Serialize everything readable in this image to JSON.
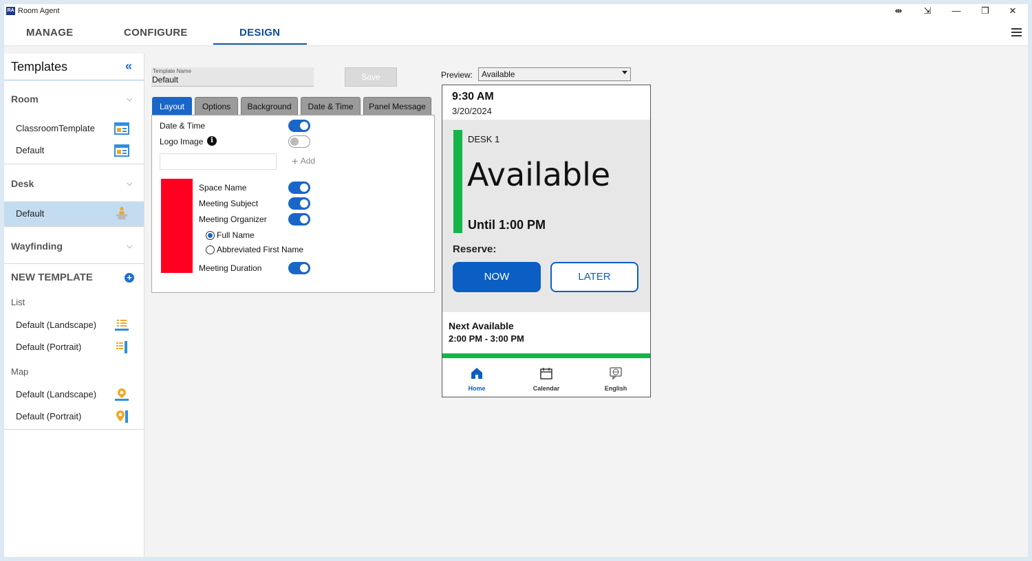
{
  "window": {
    "app_icon_text": "RA",
    "title": "Room Agent",
    "controls": [
      "⇼",
      "⇲",
      "—",
      "❐",
      "✕"
    ]
  },
  "nav": {
    "tabs": [
      {
        "label": "MANAGE",
        "active": false
      },
      {
        "label": "CONFIGURE",
        "active": false
      },
      {
        "label": "DESIGN",
        "active": true
      }
    ],
    "menu_icon": "hamburger-icon"
  },
  "sidebar": {
    "title": "Templates",
    "collapse_icon": "«",
    "room": {
      "label": "Room",
      "items": [
        {
          "label": "ClassroomTemplate",
          "icon": "room-layout-icon"
        },
        {
          "label": "Default",
          "icon": "room-layout-icon"
        }
      ]
    },
    "desk": {
      "label": "Desk",
      "items": [
        {
          "label": "Default",
          "icon": "desk-person-icon",
          "selected": true
        }
      ]
    },
    "wayfinding": {
      "label": "Wayfinding"
    },
    "new_template": {
      "label": "NEW TEMPLATE",
      "list_label": "List",
      "list_items": [
        {
          "label": "Default (Landscape)",
          "icon": "list-landscape-icon"
        },
        {
          "label": "Default (Portrait)",
          "icon": "list-portrait-icon"
        }
      ],
      "map_label": "Map",
      "map_items": [
        {
          "label": "Default (Landscape)",
          "icon": "map-pin-landscape-icon"
        },
        {
          "label": "Default (Portrait)",
          "icon": "map-pin-portrait-icon"
        }
      ]
    }
  },
  "editor": {
    "template_name_label": "Template Name",
    "template_name_value": "Default",
    "save_label": "Save",
    "tabs": [
      "Layout",
      "Options",
      "Background",
      "Date & Time",
      "Panel Message"
    ],
    "active_tab": "Layout",
    "layout": {
      "date_time_label": "Date & Time",
      "date_time_on": true,
      "logo_image_label": "Logo Image",
      "logo_image_on": false,
      "logo_input_value": "",
      "add_label": "Add",
      "swatch_color": "#ff0021",
      "space_name_label": "Space Name",
      "space_name_on": true,
      "meeting_subject_label": "Meeting Subject",
      "meeting_subject_on": true,
      "meeting_organizer_label": "Meeting Organizer",
      "meeting_organizer_on": true,
      "full_name_label": "Full Name",
      "abbreviated_label": "Abbreviated First Name",
      "organizer_format": "Full Name",
      "meeting_duration_label": "Meeting Duration",
      "meeting_duration_on": true
    }
  },
  "preview": {
    "label": "Preview:",
    "selected": "Available",
    "device": {
      "time": "9:30 AM",
      "date": "3/20/2024",
      "space_name": "DESK 1",
      "status": "Available",
      "until": "Until 1:00 PM",
      "reserve_label": "Reserve:",
      "now_label": "NOW",
      "later_label": "LATER",
      "next_available_label": "Next Available",
      "next_available_value": "2:00 PM - 3:00 PM",
      "status_color": "#16b54a",
      "bottom_nav": [
        {
          "label": "Home",
          "icon": "home-icon",
          "active": true
        },
        {
          "label": "Calendar",
          "icon": "calendar-icon",
          "active": false
        },
        {
          "label": "English",
          "icon": "language-icon",
          "active": false
        }
      ]
    }
  },
  "colors": {
    "accent": "#1a66c8",
    "nav_active": "#0e4d9a",
    "selected_item": "#c4dcf0"
  }
}
